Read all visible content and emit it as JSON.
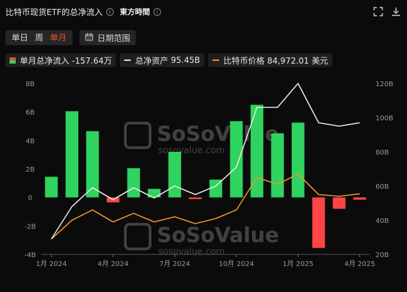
{
  "header": {
    "title": "比特币现货ETF的总净流入",
    "source": "東方時間"
  },
  "controls": {
    "periods": [
      "单日",
      "周",
      "单月"
    ],
    "active_period": "单月",
    "date_range_label": "日期范围"
  },
  "legend": {
    "flow": {
      "label": "单月总净流入",
      "value": "-157.64万"
    },
    "assets": {
      "label": "总净资产",
      "value": "95.45B"
    },
    "price": {
      "label": "比特币价格",
      "value": "84,972.01 美元"
    }
  },
  "watermark": {
    "brand": "SoSoValue",
    "url": "sosovalue.com"
  },
  "colors": {
    "positive": "#2fd35f",
    "negative": "#ff4444",
    "assets_line": "#e8e8e8",
    "price_line": "#f0952e",
    "accent": "#f0522c"
  },
  "chart_data": {
    "type": "bar",
    "categories": [
      "2024-01",
      "2024-02",
      "2024-03",
      "2024-04",
      "2024-05",
      "2024-06",
      "2024-07",
      "2024-08",
      "2024-09",
      "2024-10",
      "2024-11",
      "2024-12",
      "2025-01",
      "2025-02",
      "2025-03",
      "2025-04"
    ],
    "x_tick_labels": [
      {
        "index": 0,
        "label": "1月 2024"
      },
      {
        "index": 3,
        "label": "4月 2024"
      },
      {
        "index": 6,
        "label": "7月 2024"
      },
      {
        "index": 9,
        "label": "10月 2024"
      },
      {
        "index": 12,
        "label": "1月 2025"
      },
      {
        "index": 15,
        "label": "4月 2025"
      }
    ],
    "series": [
      {
        "values": [
          1.45,
          6.05,
          4.65,
          -0.35,
          2.05,
          0.6,
          3.2,
          -0.12,
          1.25,
          5.35,
          6.5,
          4.5,
          5.25,
          -3.55,
          -0.8,
          -0.16
        ],
        "axis": "left"
      },
      {
        "values": [
          29,
          48,
          59,
          52,
          59,
          53,
          60,
          55,
          60,
          71,
          106,
          106,
          120,
          97,
          95,
          97
        ],
        "axis": "right"
      },
      {
        "values": [
          29,
          40,
          46,
          39,
          44,
          39,
          42,
          38,
          41,
          46,
          65,
          61,
          67,
          55,
          54,
          55.5
        ],
        "axis": "right"
      }
    ],
    "left_axis": {
      "min": -4,
      "max": 8,
      "ticks": [
        -4,
        -2,
        0,
        2,
        4,
        6,
        8
      ],
      "tick_labels": [
        "-4B",
        "-2B",
        "0",
        "2B",
        "4B",
        "6B",
        "8B"
      ]
    },
    "right_axis": {
      "min": 20,
      "max": 120,
      "ticks": [
        20,
        40,
        60,
        80,
        100,
        120
      ],
      "tick_labels": [
        "20B",
        "40B",
        "60B",
        "80B",
        "100B",
        "120B"
      ]
    },
    "grid": false
  }
}
